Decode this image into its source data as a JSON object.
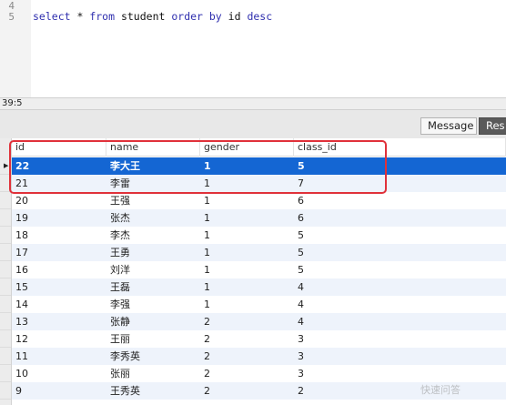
{
  "editor": {
    "line_numbers": [
      "4",
      "5"
    ],
    "sql": {
      "kw1": "select",
      "star": " * ",
      "kw2": "from",
      "table": " student ",
      "kw3": "order by",
      "col": " id ",
      "kw4": "desc"
    }
  },
  "status": {
    "cursor": "39:5"
  },
  "tabs": {
    "message": "Message",
    "result": "Res"
  },
  "grid": {
    "columns": [
      "id",
      "name",
      "gender",
      "class_id"
    ],
    "rows": [
      [
        "22",
        "李大王",
        "1",
        "5"
      ],
      [
        "21",
        "李雷",
        "1",
        "7"
      ],
      [
        "20",
        "王强",
        "1",
        "6"
      ],
      [
        "19",
        "张杰",
        "1",
        "6"
      ],
      [
        "18",
        "李杰",
        "1",
        "5"
      ],
      [
        "17",
        "王勇",
        "1",
        "5"
      ],
      [
        "16",
        "刘洋",
        "1",
        "5"
      ],
      [
        "15",
        "王磊",
        "1",
        "4"
      ],
      [
        "14",
        "李强",
        "1",
        "4"
      ],
      [
        "13",
        "张静",
        "2",
        "4"
      ],
      [
        "12",
        "王丽",
        "2",
        "3"
      ],
      [
        "11",
        "李秀英",
        "2",
        "3"
      ],
      [
        "10",
        "张丽",
        "2",
        "3"
      ],
      [
        "9",
        "王秀英",
        "2",
        "2"
      ]
    ],
    "selected_row": 0
  },
  "watermark": "快速问答",
  "colors": {
    "selection": "#1466d3",
    "annotation": "#e0313a",
    "keyword": "#2f2fae"
  }
}
